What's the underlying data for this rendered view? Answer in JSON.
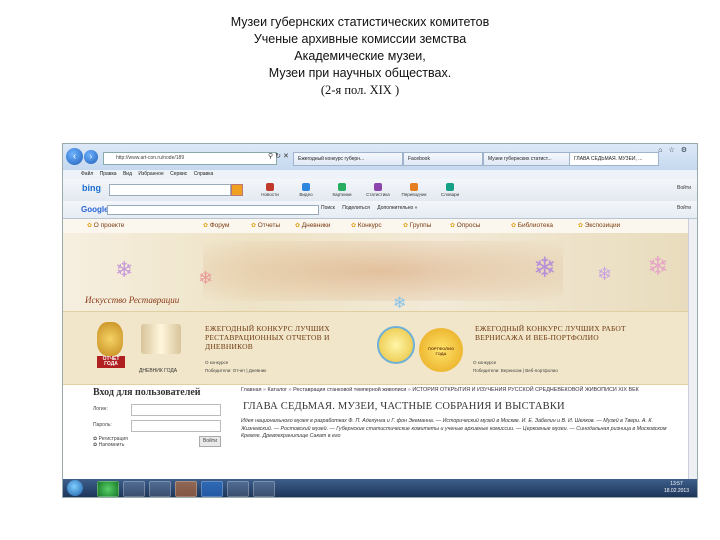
{
  "slide": {
    "lines": [
      "Музеи губернских статистических комитетов",
      "Ученые архивные комиссии земства",
      "Академические музеи,",
      "Музеи при научных обществах."
    ],
    "period": "(2-я пол. XIX )"
  },
  "browser": {
    "address": "http://www.art-con.ru/node/189",
    "tabs": [
      "Ежегодный конкурс губерн...",
      "Facebook",
      "Музеи губернских статист...",
      "ГЛАВА СЕДЬМАЯ. МУЗЕИ, ..."
    ],
    "menu": [
      "Файл",
      "Правка",
      "Вид",
      "Избранное",
      "Сервис",
      "Справка"
    ],
    "bing": {
      "logo": "bing",
      "buttons": [
        "Новости",
        "Видео",
        "Картинки",
        "Статистика",
        "Переводчик",
        "Словари"
      ],
      "right": "Войти"
    },
    "google": {
      "logo": "Google",
      "items": [
        "Поиск",
        "Поделиться",
        "Дополнительно »"
      ],
      "right": "Войти"
    }
  },
  "site": {
    "nav": [
      "О проекте",
      "Форум",
      "Отчеты",
      "Дневники",
      "Конкурс",
      "Группы",
      "Опросы",
      "Библиотека",
      "Экспозиции"
    ],
    "banner_logo": "Искусство Реставрации",
    "contest_left": {
      "title": "ЕЖЕГОДНЫЙ КОНКУРС ЛУЧШИХ РЕСТАВРАЦИОННЫХ ОТЧЕТОВ И ДНЕВНИКОВ",
      "link1": "О конкурсе",
      "link2": "Победители: Отчет | Дневник",
      "medal_caption": "ОТЧЕТ ГОДА",
      "diary_caption": "ДНЕВНИК ГОДА"
    },
    "contest_right": {
      "title": "ЕЖЕГОДНЫЙ КОНКУРС ЛУЧШИХ РАБОТ ВЕРНИСАЖА И ВЕБ-ПОРТФОЛИО",
      "link1": "О конкурсе",
      "link2": "Победители: Вернисаж | Веб-портфолио",
      "medal_caption": "ПОРТФОЛИО ГОДА"
    },
    "login": {
      "title": "Вход для пользователей",
      "login_label": "Логин:",
      "password_label": "Пароль:",
      "register": "Регистрация",
      "forgot": "Напомнить",
      "submit": "Войти"
    },
    "breadcrumb": [
      "Главная",
      "Каталог",
      "Реставрация станковой темперной живописи",
      "ИСТОРИЯ ОТКРЫТИЯ И ИЗУЧЕНИЯ РУССКОЙ СРЕДНЕВЕКОВОЙ ЖИВОПИСИ XIX ВЕК"
    ],
    "chapter_title": "ГЛАВА СЕДЬМАЯ. МУЗЕИ, ЧАСТНЫЕ СОБРАНИЯ И ВЫСТАВКИ",
    "paragraph": "Идея национального музея в разработках Ф. П. Аделунга и Г. фон Экеманна. — Исторический музей в Москве. И. Е. Забелин и В. И. Шелков. — Музей в Твери. А. К. Жизневский. — Ростовский музей. — Губернские статистические комитеты и ученые архивные комиссии. — Церковные музеи. — Синодальная ризница в Московском Кремле. Древлехранилище Сакат в его"
  },
  "taskbar": {
    "time": "13:57",
    "date": "18.02.2013"
  },
  "colors": {
    "site_nav_text": "#7a3b10",
    "contest_bg": "#f1e6c9",
    "taskbar": "#1e355a"
  }
}
